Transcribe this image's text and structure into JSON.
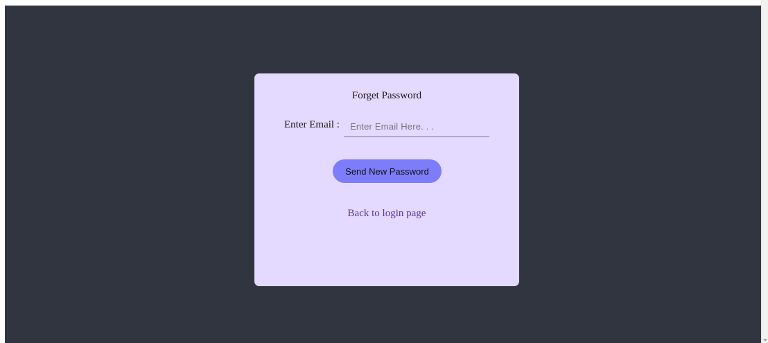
{
  "form": {
    "title": "Forget Password",
    "email_label": "Enter Email :",
    "email_value": "",
    "email_placeholder": "Enter Email Here. . .",
    "submit_label": "Send New Password",
    "back_link_label": "Back to login page"
  },
  "colors": {
    "page_background": "#31353f",
    "card_background": "#e4d9fe",
    "button_background": "#7d7dfb",
    "link_color": "#5a3494"
  }
}
